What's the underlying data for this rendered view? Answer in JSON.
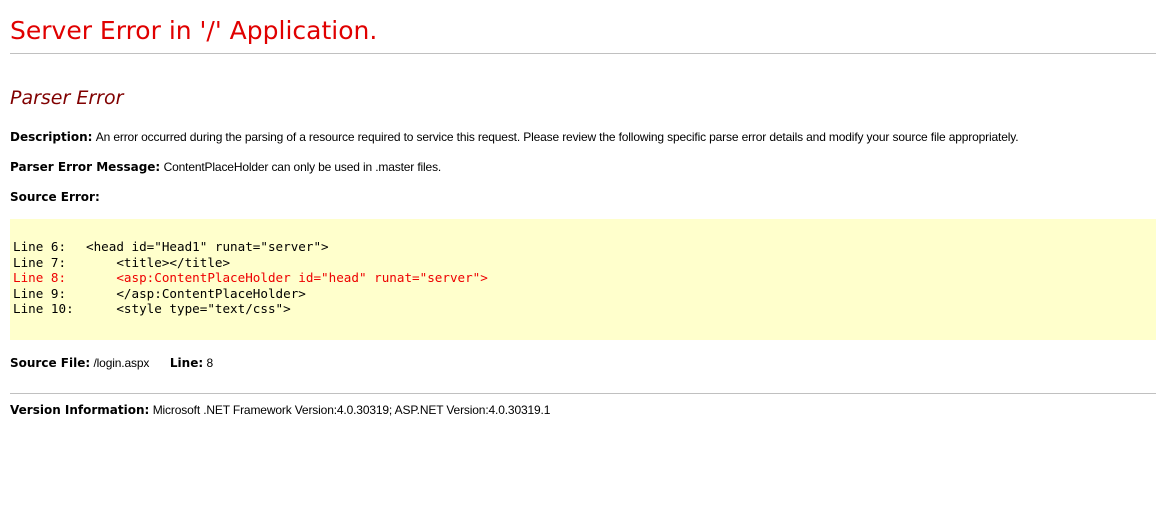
{
  "page": {
    "title": "Server Error in '/' Application.",
    "subtitle": "Parser Error",
    "description": {
      "label": "Description:",
      "value": "An error occurred during the parsing of a resource required to service this request. Please review the following specific parse error details and modify your source file appropriately."
    },
    "parser_error_message": {
      "label": "Parser Error Message:",
      "value": "ContentPlaceHolder can only be used in .master files."
    },
    "source_error": {
      "label": "Source Error:",
      "lines": [
        {
          "num": "Line 6:",
          "code": "<head id=\"Head1\" runat=\"server\">",
          "highlight": false
        },
        {
          "num": "Line 7:",
          "code": "    <title></title>",
          "highlight": false
        },
        {
          "num": "Line 8:",
          "code": "    <asp:ContentPlaceHolder id=\"head\" runat=\"server\">",
          "highlight": true
        },
        {
          "num": "Line 9:",
          "code": "    </asp:ContentPlaceHolder>",
          "highlight": false
        },
        {
          "num": "Line 10:",
          "code": "    <style type=\"text/css\">",
          "highlight": false
        }
      ]
    },
    "source_file": {
      "label": "Source File:",
      "value": "/login.aspx",
      "line_label": "Line:",
      "line_value": "8"
    },
    "version_information": {
      "label": "Version Information:",
      "value": "Microsoft .NET Framework Version:4.0.30319; ASP.NET Version:4.0.30319.1"
    }
  },
  "colors": {
    "title": "#e00000",
    "subtitle": "#800000",
    "code_background": "#ffffcc",
    "highlight_line": "#ee0000",
    "rule": "#c0c0c0"
  }
}
